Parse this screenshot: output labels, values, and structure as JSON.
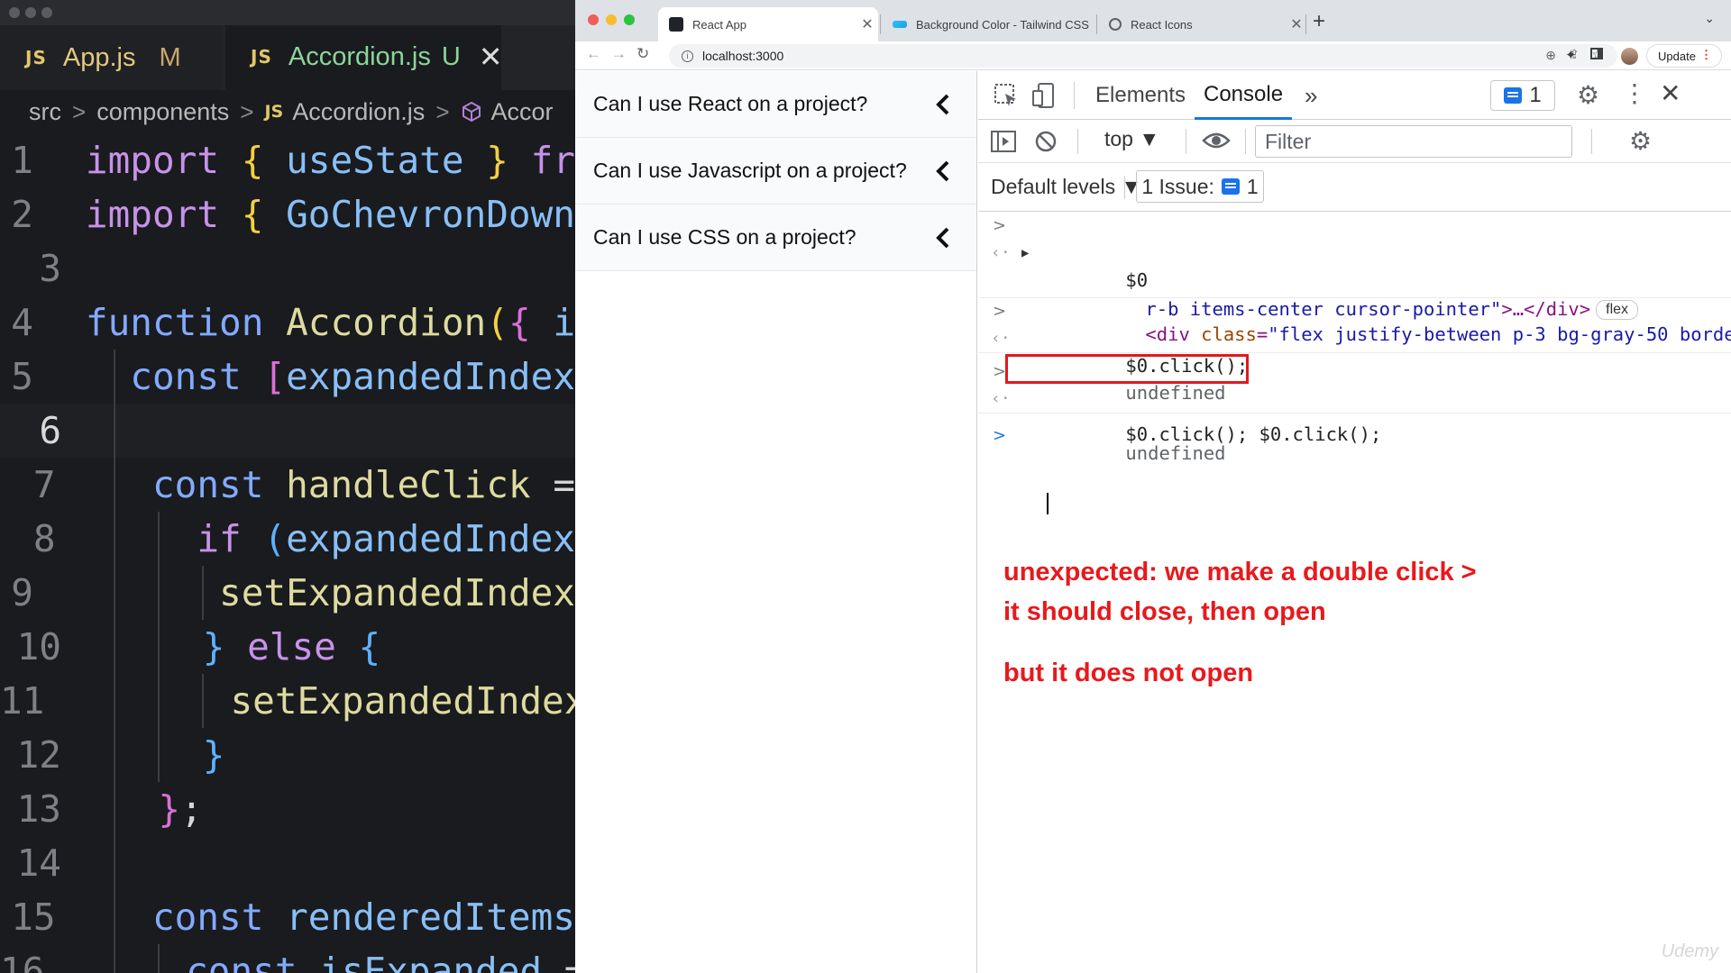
{
  "vscode": {
    "tabs": [
      {
        "badge": "JS",
        "name": "App.js",
        "status": "M",
        "active": false
      },
      {
        "badge": "JS",
        "name": "Accordion.js",
        "status": "U",
        "active": true,
        "close": "✕"
      }
    ],
    "breadcrumb": {
      "items": [
        "src",
        "components",
        "Accordion.js",
        "Accor"
      ],
      "file_badge": "JS"
    },
    "lines": [
      {
        "n": "1",
        "tokens": [
          [
            "kw",
            "import "
          ],
          [
            "br",
            "{ "
          ],
          [
            "var",
            "useState "
          ],
          [
            "br",
            "} "
          ],
          [
            "kw",
            "fr"
          ]
        ]
      },
      {
        "n": "2",
        "tokens": [
          [
            "kw",
            "import "
          ],
          [
            "br",
            "{ "
          ],
          [
            "var",
            "GoChevronDown"
          ]
        ]
      },
      {
        "n": "3",
        "tokens": []
      },
      {
        "n": "4",
        "tokens": [
          [
            "kw2",
            "function "
          ],
          [
            "fn",
            "Accordion"
          ],
          [
            "br",
            "("
          ],
          [
            "br2",
            "{ "
          ],
          [
            "var",
            "i"
          ]
        ]
      },
      {
        "n": "5",
        "tokens": [
          [
            "pl",
            "  "
          ],
          [
            "kw2",
            "const "
          ],
          [
            "br2",
            "["
          ],
          [
            "var",
            "expandedIndex"
          ]
        ]
      },
      {
        "n": "6",
        "tokens": []
      },
      {
        "n": "7",
        "tokens": [
          [
            "pl",
            "  "
          ],
          [
            "kw2",
            "const "
          ],
          [
            "fn",
            "handleClick "
          ],
          [
            "pl",
            "="
          ]
        ]
      },
      {
        "n": "8",
        "tokens": [
          [
            "pl",
            "    "
          ],
          [
            "kw",
            "if "
          ],
          [
            "br3",
            "("
          ],
          [
            "var",
            "expandedIndex"
          ]
        ]
      },
      {
        "n": "9",
        "tokens": [
          [
            "pl",
            "      "
          ],
          [
            "fn",
            "setExpandedIndex"
          ]
        ]
      },
      {
        "n": "10",
        "tokens": [
          [
            "pl",
            "    "
          ],
          [
            "br3",
            "} "
          ],
          [
            "kw",
            "else "
          ],
          [
            "br3",
            "{"
          ]
        ]
      },
      {
        "n": "11",
        "tokens": [
          [
            "pl",
            "      "
          ],
          [
            "fn",
            "setExpandedIndex"
          ]
        ]
      },
      {
        "n": "12",
        "tokens": [
          [
            "pl",
            "    "
          ],
          [
            "br3",
            "}"
          ]
        ]
      },
      {
        "n": "13",
        "tokens": [
          [
            "pl",
            "  "
          ],
          [
            "br2",
            "}"
          ],
          [
            "pl",
            ";"
          ]
        ]
      },
      {
        "n": "14",
        "tokens": []
      },
      {
        "n": "15",
        "tokens": [
          [
            "pl",
            "  "
          ],
          [
            "kw2",
            "const "
          ],
          [
            "var",
            "renderedItems"
          ]
        ]
      },
      {
        "n": "16",
        "tokens": [
          [
            "pl",
            "    "
          ],
          [
            "kw2",
            "const "
          ],
          [
            "var",
            "isExpanded "
          ],
          [
            "pl",
            "="
          ]
        ]
      }
    ]
  },
  "browser": {
    "tabs": [
      {
        "title": "React App",
        "close": "✕"
      },
      {
        "title": "Background Color - Tailwind CSS",
        "close": "✕"
      },
      {
        "title": "React Icons",
        "close": "✕"
      }
    ],
    "new_tab": "+",
    "url": "localhost:3000",
    "update_label": "Update"
  },
  "page": {
    "items": [
      {
        "label": "Can I use React on a project?"
      },
      {
        "label": "Can I use Javascript on a project?"
      },
      {
        "label": "Can I use CSS on a project?"
      }
    ]
  },
  "devtools": {
    "tabs": {
      "elements": "Elements",
      "console": "Console",
      "more": "»"
    },
    "issue_count": "1",
    "context": "top ▼",
    "filter_placeholder": "Filter",
    "levels": "Default levels ▼",
    "issues_label": "1 Issue:",
    "issues_count": "1",
    "console": {
      "e1_input": "$0",
      "e1_out_pre": "<div ",
      "e1_attr": "class",
      "e1_eq": "=",
      "e1_val1": "\"flex justify-between p-3 bg-gray-50 borde",
      "e1_val2": "r-b items-center cursor-pointer\"",
      "e1_tail": ">…</div>",
      "e1_badge": "flex",
      "e2_input": "$0.click();",
      "e2_out": "undefined",
      "e3_input": "$0.click(); $0.click();",
      "e3_out": "undefined"
    },
    "annotation": {
      "line1": "unexpected: we make a double click >",
      "line2": "it should close, then open",
      "line3": "but it does not open"
    },
    "accent_color": "#1a73e8",
    "annotation_color": "#e8191c"
  },
  "watermark": "Udemy"
}
